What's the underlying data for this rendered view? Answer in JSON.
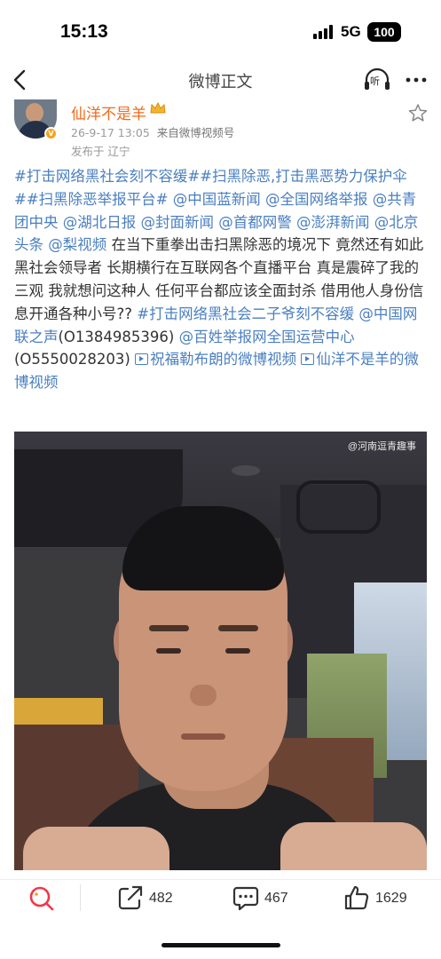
{
  "status_bar": {
    "time": "15:13",
    "network": "5G",
    "battery": "100"
  },
  "nav": {
    "title": "微博正文",
    "listen_label": "听"
  },
  "author": {
    "name": "仙洋不是羊",
    "timestamp": "26-9-17 13:05",
    "source": "来自微博视频号",
    "location": "发布于 辽宁"
  },
  "post": {
    "segments": [
      {
        "type": "link",
        "text": "#打击网络黑社会刻不容缓##扫黑除恶,打击黑恶势力保护伞##扫黑除恶举报平台# @中国蓝新闻 @全国网络举报 @共青团中央 @湖北日报 @封面新闻 @首都网警 @澎湃新闻 @北京头条 @梨视频"
      },
      {
        "type": "text",
        "text": " 在当下重拳出击扫黑除恶的境况下  竟然还有如此黑社会领导者 长期横行在互联网各个直播平台  真是震碎了我的三观  我就想问这种人 任何平台都应该全面封杀 借用他人身份信息开通各种小号?? "
      },
      {
        "type": "link",
        "text": "#打击网络黑社会二子爷刻不容缓 @中国网联之声"
      },
      {
        "type": "text",
        "text": "(O1384985396) "
      },
      {
        "type": "link",
        "text": "@百姓举报网全国运营中心"
      },
      {
        "type": "text",
        "text": "(O5550028203) "
      },
      {
        "type": "video-link",
        "text": "祝福勒布朗的微博视频 "
      },
      {
        "type": "video-link",
        "text": "仙洋不是羊的微博视频"
      }
    ]
  },
  "video": {
    "watermark": "@河南逗青趣事"
  },
  "actions": {
    "repost_count": "482",
    "comment_count": "467",
    "like_count": "1629"
  },
  "colors": {
    "accent_orange": "#f26a1b",
    "link_blue": "#4a7fc0",
    "meta_gray": "#9a9a9a"
  }
}
